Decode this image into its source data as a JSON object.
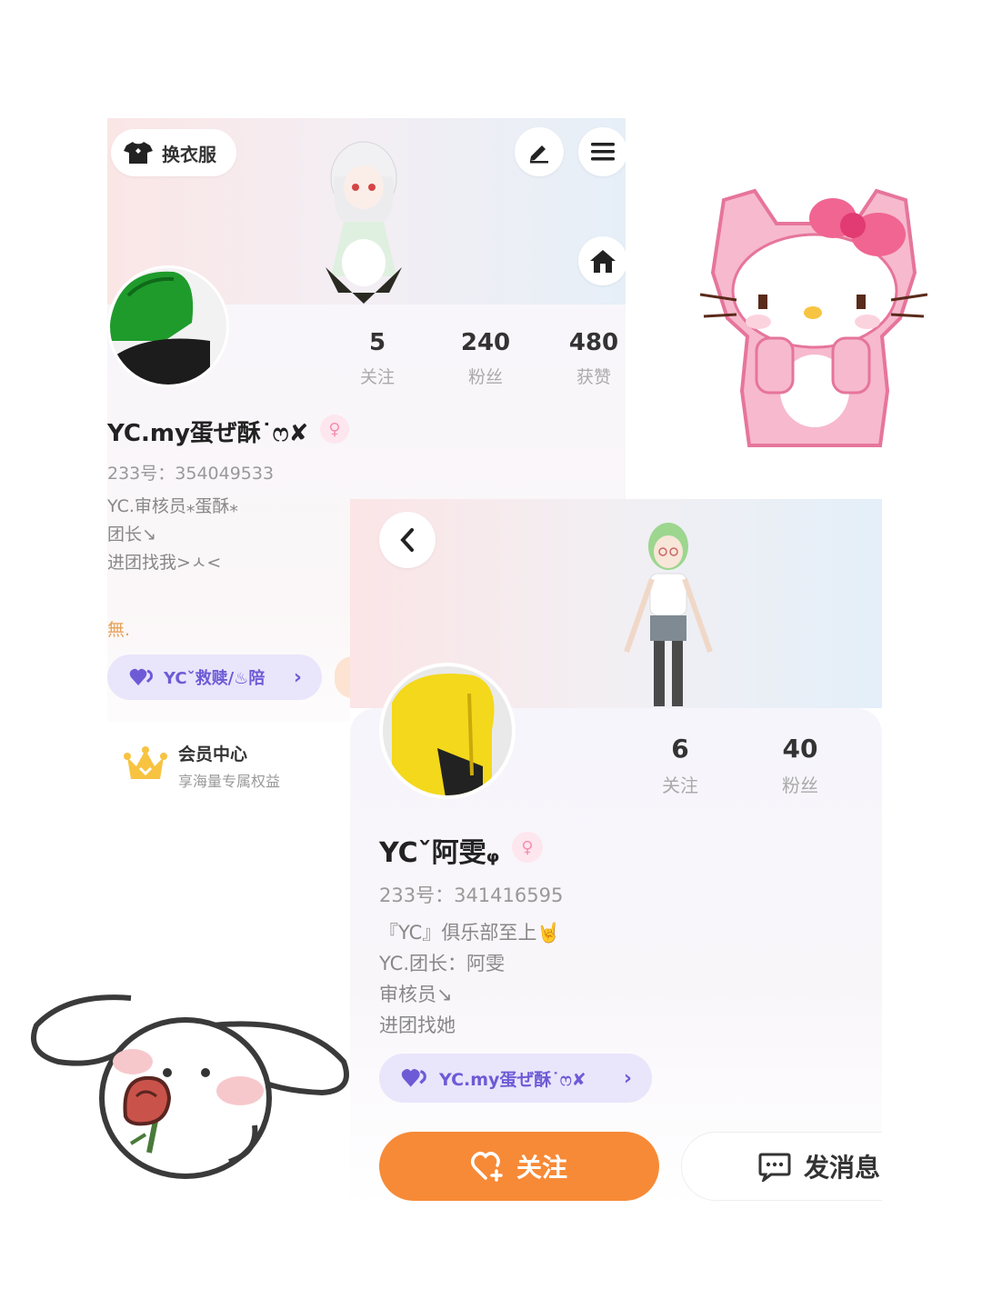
{
  "card_a": {
    "wardrobe_label": "换衣服",
    "stats": [
      {
        "value": "5",
        "label": "关注"
      },
      {
        "value": "240",
        "label": "粉丝"
      },
      {
        "value": "480",
        "label": "获赞"
      }
    ],
    "username": "YC.my蛋ぜ酥˙ෆ✘",
    "gender_symbol": "♀",
    "id_line": "233号：354049533",
    "bio_lines": [
      "YC.审核员⁎蛋酥⁎",
      "团长↘",
      "进团找我>ㅅ<"
    ],
    "extra_text": "無.",
    "club_label": "YCˇ救赎/♨陪",
    "vip_title": "会员中心",
    "vip_subtitle": "享海量专属权益"
  },
  "card_b": {
    "stats": [
      {
        "value": "6",
        "label": "关注"
      },
      {
        "value": "40",
        "label": "粉丝"
      }
    ],
    "username": "YCˇ阿雯ᵩ",
    "gender_symbol": "♀",
    "id_line": "233号：341416595",
    "bio_lines": [
      "『YC』俱乐部至上🤘",
      "YC.团长：阿雯",
      "审核员↘",
      "进团找她"
    ],
    "club_label": "YC.my蛋ぜ酥˙ෆ✘",
    "follow_label": "关注",
    "message_label": "发消息"
  },
  "colors": {
    "accent_orange": "#f78a37",
    "club_purple": "#6d5bd6",
    "gender_pink": "#f58fb0"
  }
}
